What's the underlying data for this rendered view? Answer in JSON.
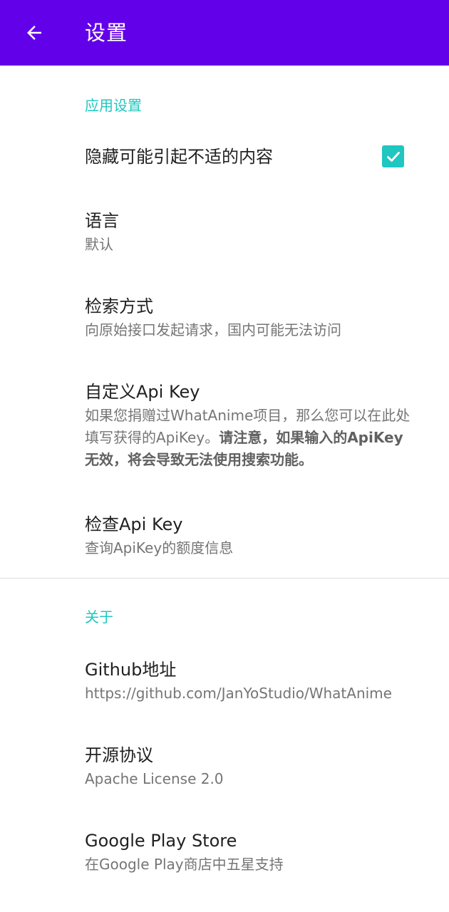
{
  "appbar": {
    "title": "设置"
  },
  "sections": {
    "app": {
      "header": "应用设置",
      "hide_nsfw": {
        "title": "隐藏可能引起不适的内容",
        "checked": true
      },
      "language": {
        "title": "语言",
        "summary": "默认"
      },
      "search_mode": {
        "title": "检索方式",
        "summary": "向原始接口发起请求，国内可能无法访问"
      },
      "custom_api_key": {
        "title": "自定义Api Key",
        "summary_plain": "如果您捐赠过WhatAnime项目，那么您可以在此处填写获得的ApiKey。",
        "summary_bold": "请注意，如果输入的ApiKey无效，将会导致无法使用搜索功能。"
      },
      "check_api_key": {
        "title": "检查Api Key",
        "summary": "查询ApiKey的额度信息"
      }
    },
    "about": {
      "header": "关于",
      "github": {
        "title": "Github地址",
        "summary": "https://github.com/JanYoStudio/WhatAnime"
      },
      "license": {
        "title": "开源协议",
        "summary": "Apache License 2.0"
      },
      "play_store": {
        "title": "Google Play Store",
        "summary": "在Google Play商店中五星支持"
      }
    }
  },
  "colors": {
    "appbar": "#6200ea",
    "accent": "#1fc7c0"
  }
}
